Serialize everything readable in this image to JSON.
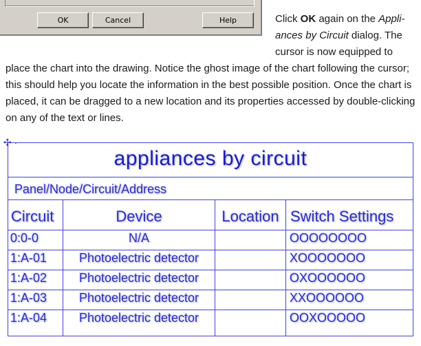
{
  "dialog": {
    "ok_label": "OK",
    "cancel_label": "Cancel",
    "help_label": "Help"
  },
  "instructions": {
    "p1_pre": "Click ",
    "p1_bold": "OK",
    "p1_mid": " again on the ",
    "p1_italic": "Appli-ances by Circuit",
    "p1_post": " dialog. The cursor is now equipped to",
    "p2": "place the chart into the drawing. Notice the ghost image of the chart following the cursor; this should help you locate the information in the best possible position. Once the chart is placed, it can be dragged to a new location and its properties accessed by double-clicking on any of the text or lines."
  },
  "chart": {
    "title": "appliances by circuit",
    "subtitle": "Panel/Node/Circuit/Address",
    "headers": [
      "Circuit",
      "Device",
      "Location",
      "Switch Settings"
    ],
    "rows": [
      [
        "0:0-0",
        "N/A",
        "",
        "OOOOOOOO"
      ],
      [
        "1:A-01",
        "Photoelectric detector",
        "",
        "XOOOOOOO"
      ],
      [
        "1:A-02",
        "Photoelectric detector",
        "",
        "OXOOOOOO"
      ],
      [
        "1:A-03",
        "Photoelectric detector",
        "",
        "XXOOOOOO"
      ],
      [
        "1:A-04",
        "Photoelectric detector",
        "",
        "OOXOOOOO"
      ]
    ]
  }
}
